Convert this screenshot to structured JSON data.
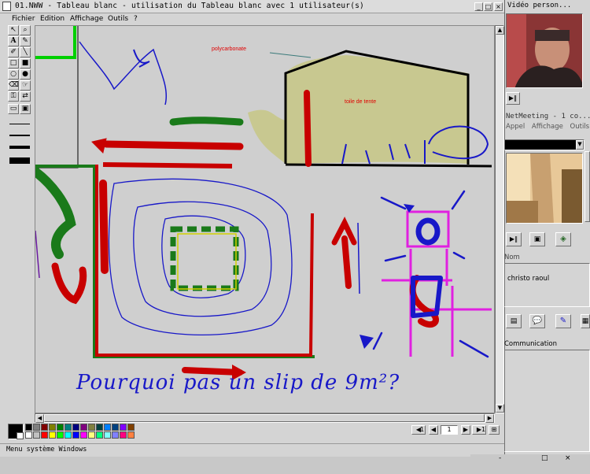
{
  "main_window": {
    "title": "01.NWW - Tableau blanc - utilisation du Tableau blanc avec 1 utilisateur(s)",
    "menu": [
      "Fichier",
      "Edition",
      "Affichage",
      "Outils",
      "?"
    ],
    "window_buttons": [
      "_",
      "□",
      "×"
    ]
  },
  "toolbox": {
    "tools": [
      "select-arrow",
      "zoom",
      "text",
      "highlighter",
      "pen",
      "line",
      "rect-empty",
      "rect-filled",
      "ellipse-empty",
      "ellipse-filled",
      "eraser",
      "remote-pointer",
      "lock-contents",
      "sync-page",
      "new-page",
      "page-view"
    ],
    "text_tool_glyph": "A"
  },
  "canvas": {
    "labels": {
      "polycarbonate": "polycarbonate",
      "toile": "toile de tente"
    },
    "handwriting": "Pourquoi pas un slip de 9m²?",
    "colors": {
      "red": "#e00000",
      "green": "#1a7a1a",
      "blue": "#1818c8",
      "khaki": "#c8c890",
      "magenta": "#e020e0",
      "black": "#000000",
      "lime": "#00d000"
    }
  },
  "palette": {
    "colors": [
      "#000000",
      "#808080",
      "#800000",
      "#808000",
      "#008000",
      "#008080",
      "#000080",
      "#800080",
      "#808040",
      "#004040",
      "#0080ff",
      "#004080",
      "#8000ff",
      "#804000",
      "#ffffff",
      "#c0c0c0",
      "#ff0000",
      "#ffff00",
      "#00ff00",
      "#00ffff",
      "#0000ff",
      "#ff00ff",
      "#ffff80",
      "#00ff80",
      "#80ffff",
      "#8080ff",
      "#ff0080",
      "#ff8040"
    ]
  },
  "pagenav": {
    "first_page": "1",
    "current_page": "1",
    "total_pages": "1"
  },
  "statusbar": {
    "text": "Menu système Windows"
  },
  "video_window": {
    "title": "Vidéo person..."
  },
  "netmeeting": {
    "title": "NetMeeting - 1 co...",
    "menu": [
      "Appel",
      "Affichage",
      "Outils",
      "?"
    ],
    "people_header": "Nom",
    "participant": "christo raoul",
    "communication": "Communication"
  },
  "window_controls": [
    "-",
    "□",
    "×"
  ]
}
